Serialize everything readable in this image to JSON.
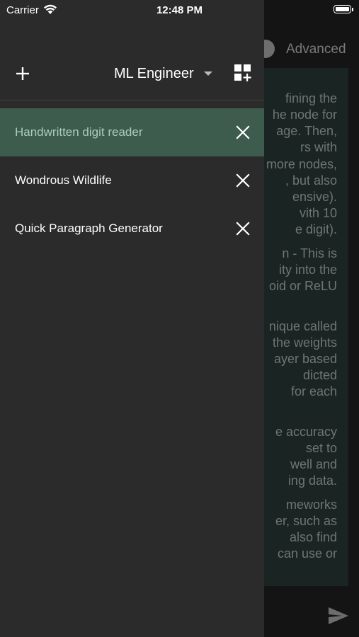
{
  "status_bar": {
    "carrier": "Carrier",
    "time": "12:48 PM"
  },
  "background": {
    "mode_label": "Advanced",
    "text_fragments": [
      "fining the",
      "he node for",
      "age. Then,",
      "rs with",
      "more nodes,",
      ", but also",
      "ensive).",
      "vith 10",
      "e digit).",
      "n - This is",
      "ity into the",
      "oid or ReLU",
      "nique called",
      "the weights",
      "ayer based",
      "dicted",
      "for each",
      "e accuracy",
      "set to",
      "well and",
      "ing data.",
      "meworks",
      "er, such as",
      "also find",
      "can use or"
    ]
  },
  "drawer": {
    "role": "ML Engineer",
    "items": [
      {
        "label": "Handwritten digit reader",
        "active": true
      },
      {
        "label": "Wondrous Wildlife",
        "active": false
      },
      {
        "label": "Quick Paragraph Generator",
        "active": false
      }
    ]
  },
  "colors": {
    "drawer_bg": "#2b2b2b",
    "active_item_bg": "#3e5c4e",
    "active_item_text": "#a8cdbd"
  },
  "icons": [
    "wifi-icon",
    "battery-icon",
    "plus-icon",
    "caret-down-icon",
    "add-grid-icon",
    "close-icon",
    "send-icon"
  ]
}
